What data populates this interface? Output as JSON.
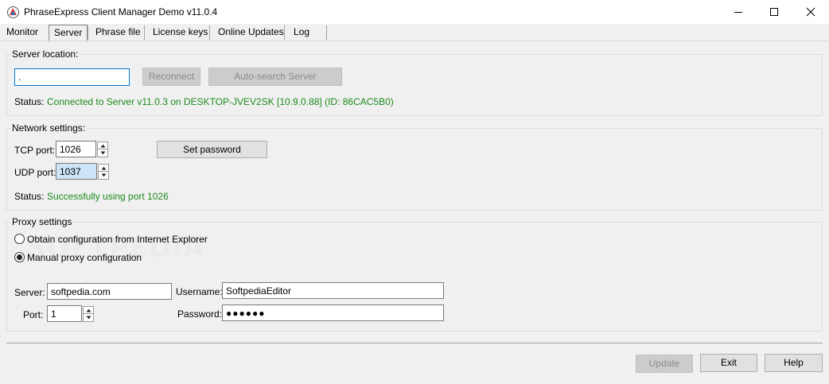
{
  "window": {
    "title": "PhraseExpress Client Manager Demo v11.0.4",
    "icon": "phraseexpress-logo-icon",
    "controls": [
      "minimize-icon",
      "maximize-icon",
      "close-icon"
    ]
  },
  "tabs": [
    {
      "label": "Monitor",
      "active": false
    },
    {
      "label": "Server",
      "active": true
    },
    {
      "label": "Phrase file",
      "active": false
    },
    {
      "label": "License keys",
      "active": false
    },
    {
      "label": "Online Updates",
      "active": false
    },
    {
      "label": "Log",
      "active": false
    }
  ],
  "server_location": {
    "title": "Server location:",
    "address_value": ".",
    "reconnect_label": "Reconnect",
    "autosearch_label": "Auto-search Server",
    "status_label": "Status:",
    "status_text": "Connected to Server v11.0.3 on DESKTOP-JVEV2SK [10.9.0.88] (ID: 86CAC5B0)"
  },
  "network": {
    "title": "Network settings:",
    "tcp_label": "TCP port:",
    "tcp_value": "1026",
    "udp_label": "UDP port:",
    "udp_value": "1037",
    "set_password_label": "Set password",
    "status_label": "Status:",
    "status_text": "Successfully using port 1026"
  },
  "proxy": {
    "title": "Proxy settings",
    "option_ie": "Obtain configuration from Internet Explorer",
    "option_manual": "Manual proxy configuration",
    "selected": "manual",
    "server_label": "Server:",
    "server_value": "softpedia.com",
    "port_label": "Port:",
    "port_value": "1",
    "username_label": "Username:",
    "username_value": "SoftpediaEditor",
    "password_label": "Password:",
    "password_value": "●●●●●●"
  },
  "watermark": "SOFTPEDIA",
  "footer": {
    "update_label": "Update",
    "exit_label": "Exit",
    "help_label": "Help"
  },
  "colors": {
    "status_green": "#1c8a1c",
    "focus_border": "#0078d7",
    "highlight_field": "#cce4f7"
  }
}
